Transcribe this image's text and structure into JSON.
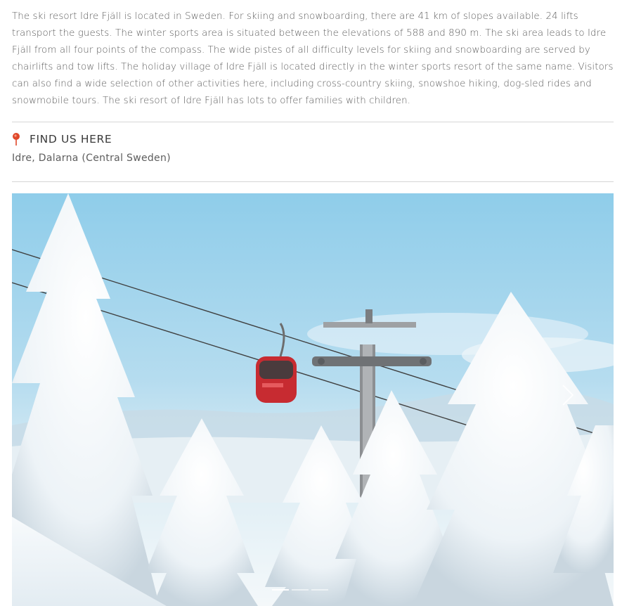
{
  "description": "The ski resort Idre Fjäll is located in Sweden. For skiing and snowboarding, there are 41 km of slopes available. 24 lifts transport the guests. The winter sports area is situated between the elevations of 588 and 890 m. The ski area leads to Idre Fjäll from all four points of the compass. The wide pistes of all difficulty levels for skiing and snowboarding are served by chairlifts and tow lifts. The holiday village of Idre Fjäll is located directly in the winter sports resort of the same name. Visitors can also find a wide selection of other activities here, including cross-country skiing, snowshoe hiking, dog-sled rides and snowmobile tours. The ski resort of Idre Fjäll has lots to offer families with children.",
  "location": {
    "icon": "map-pin-icon",
    "heading": "FIND US HERE",
    "address": "Idre, Dalarna (Central Sweden)"
  },
  "slider": {
    "image": "gondola-lift-snowy-trees",
    "next_icon": "chevron-right-icon",
    "slide_count": 3,
    "active_index": 0
  },
  "colors": {
    "accent": "#e0482a",
    "text": "#5d5d5d",
    "divider": "#d6d6d6"
  }
}
